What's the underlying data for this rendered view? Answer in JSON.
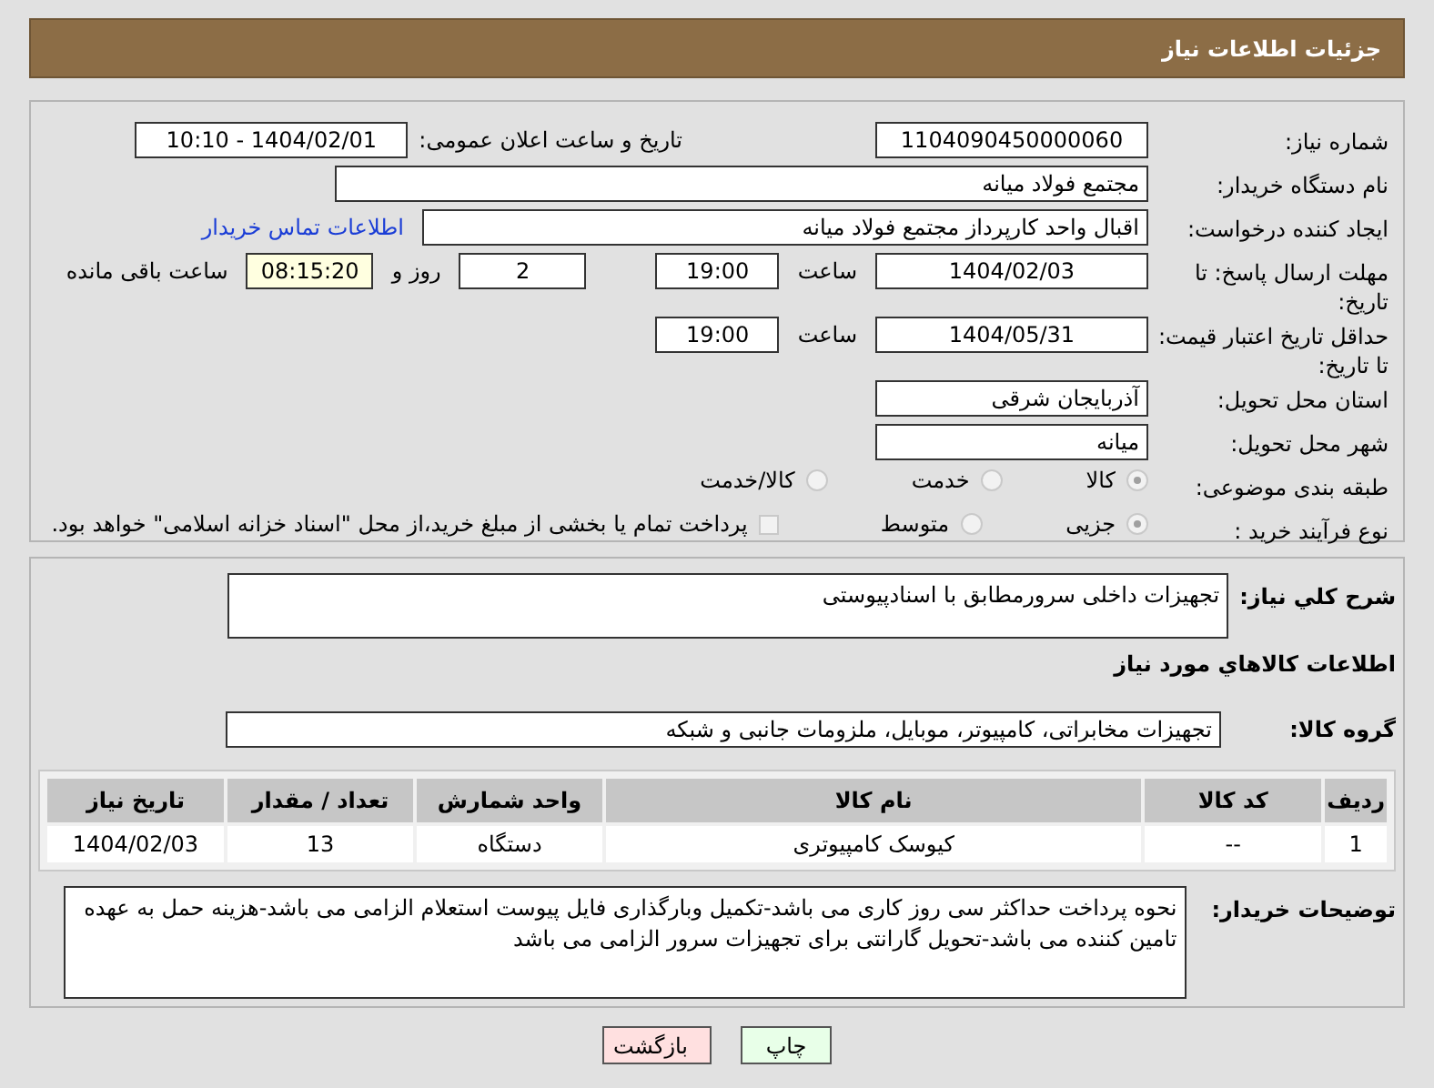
{
  "header": {
    "title": "جزئیات اطلاعات نیاز"
  },
  "need_number": {
    "label": "شماره نیاز:",
    "value": "1104090450000060"
  },
  "announce": {
    "label": "تاریخ و ساعت اعلان عمومی:",
    "value": "1404/02/01 - 10:10"
  },
  "buyer_org": {
    "label": "نام دستگاه خریدار:",
    "value": "مجتمع فولاد میانه"
  },
  "requester": {
    "label": "ایجاد کننده درخواست:",
    "value": "اقبال واحد کارپرداز مجتمع فولاد میانه",
    "link": "اطلاعات تماس خریدار"
  },
  "reply_deadline": {
    "label": "مهلت ارسال پاسخ: تا تاریخ:",
    "date": "1404/02/03",
    "time_label": "ساعت",
    "time": "19:00",
    "days": "2",
    "days_label": "روز و",
    "remaining": "08:15:20",
    "remaining_label": "ساعت باقی مانده"
  },
  "price_validity": {
    "label": "حداقل تاریخ اعتبار قیمت: تا تاریخ:",
    "date": "1404/05/31",
    "time_label": "ساعت",
    "time": "19:00"
  },
  "province": {
    "label": "استان محل تحویل:",
    "value": "آذربایجان شرقی"
  },
  "city": {
    "label": "شهر محل تحویل:",
    "value": "میانه"
  },
  "category": {
    "label": "طبقه بندی موضوعی:",
    "options": [
      {
        "label": "کالا",
        "selected": true
      },
      {
        "label": "خدمت",
        "selected": false
      },
      {
        "label": "کالا/خدمت",
        "selected": false
      }
    ]
  },
  "process": {
    "label": "نوع فرآیند خرید :",
    "options": [
      {
        "label": "جزیی",
        "selected": true
      },
      {
        "label": "متوسط",
        "selected": false
      }
    ],
    "payment_option": {
      "label": "پرداخت تمام یا بخشی از مبلغ خرید،از محل \"اسناد خزانه اسلامی\" خواهد بود.",
      "checked": false
    }
  },
  "description": {
    "label": "شرح کلي نیاز:",
    "value": "تجهیزات داخلی سرورمطابق با اسنادپیوستی"
  },
  "goods_heading": "اطلاعات کالاهاي مورد نياز",
  "goods_group": {
    "label": "گروه کالا:",
    "value": "تجهیزات مخابراتی، کامپیوتر، موبایل، ملزومات جانبی و شبکه"
  },
  "table": {
    "columns": [
      "ردیف",
      "کد کالا",
      "نام کالا",
      "واحد شمارش",
      "تعداد / مقدار",
      "تاریخ نیاز"
    ],
    "rows": [
      [
        "1",
        "--",
        "کیوسک کامپیوتری",
        "دستگاه",
        "13",
        "1404/02/03"
      ]
    ]
  },
  "buyer_notes": {
    "label": "توضیحات خریدار:",
    "value": "نحوه پرداخت حداکثر سی روز کاری می باشد-تکمیل وبارگذاری فایل پیوست استعلام الزامی می باشد-هزینه حمل به عهده تامین کننده می باشد-تحویل گارانتی برای تجهیزات سرور الزامی می باشد"
  },
  "buttons": [
    {
      "label": "چاپ",
      "kind": "print"
    },
    {
      "label": "بازگشت",
      "kind": "back"
    }
  ]
}
